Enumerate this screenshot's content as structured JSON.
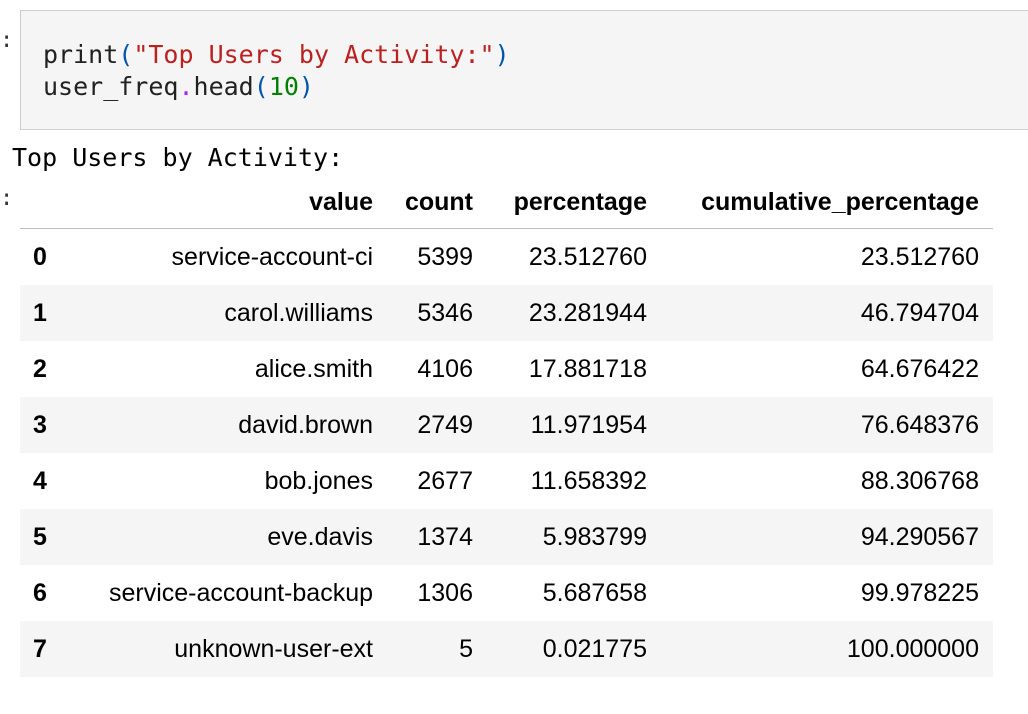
{
  "cell": {
    "code_lines": [
      [
        {
          "t": "print",
          "c": "plain"
        },
        {
          "t": "(",
          "c": "paren"
        },
        {
          "t": "\"Top Users by Activity:\"",
          "c": "str"
        },
        {
          "t": ")",
          "c": "paren"
        }
      ],
      [
        {
          "t": "user_freq",
          "c": "plain"
        },
        {
          "t": ".",
          "c": "op"
        },
        {
          "t": "head",
          "c": "plain"
        },
        {
          "t": "(",
          "c": "paren"
        },
        {
          "t": "10",
          "c": "num"
        },
        {
          "t": ")",
          "c": "paren"
        }
      ]
    ]
  },
  "output": {
    "stdout": "Top Users by Activity:",
    "table": {
      "columns": [
        "",
        "value",
        "count",
        "percentage",
        "cumulative_percentage"
      ],
      "rows": [
        {
          "index": "0",
          "value": "service-account-ci",
          "count": "5399",
          "percentage": "23.512760",
          "cumulative_percentage": "23.512760"
        },
        {
          "index": "1",
          "value": "carol.williams",
          "count": "5346",
          "percentage": "23.281944",
          "cumulative_percentage": "46.794704"
        },
        {
          "index": "2",
          "value": "alice.smith",
          "count": "4106",
          "percentage": "17.881718",
          "cumulative_percentage": "64.676422"
        },
        {
          "index": "3",
          "value": "david.brown",
          "count": "2749",
          "percentage": "11.971954",
          "cumulative_percentage": "76.648376"
        },
        {
          "index": "4",
          "value": "bob.jones",
          "count": "2677",
          "percentage": "11.658392",
          "cumulative_percentage": "88.306768"
        },
        {
          "index": "5",
          "value": "eve.davis",
          "count": "1374",
          "percentage": "5.983799",
          "cumulative_percentage": "94.290567"
        },
        {
          "index": "6",
          "value": "service-account-backup",
          "count": "1306",
          "percentage": "5.687658",
          "cumulative_percentage": "99.978225"
        },
        {
          "index": "7",
          "value": "unknown-user-ext",
          "count": "5",
          "percentage": "0.021775",
          "cumulative_percentage": "100.000000"
        }
      ]
    }
  }
}
